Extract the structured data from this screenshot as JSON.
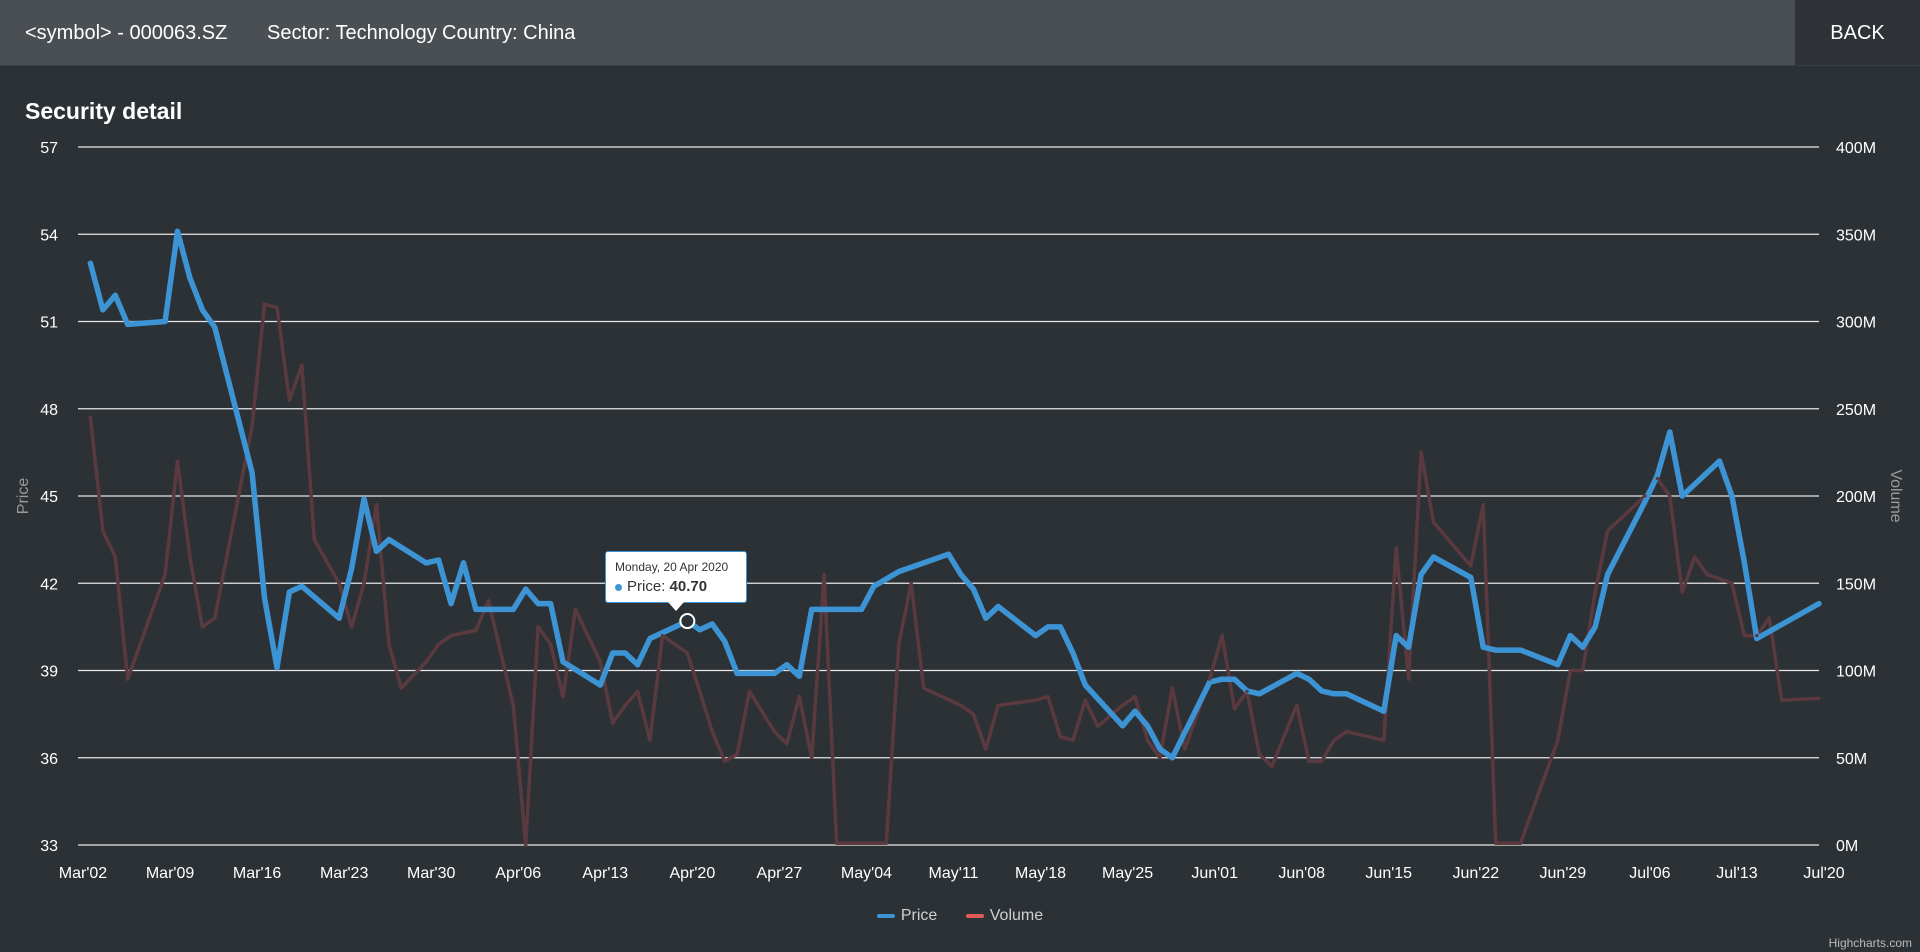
{
  "header": {
    "symbol_label": "<symbol> - 000063.SZ",
    "sector_label": "Sector: Technology",
    "country_label": "Country: China",
    "back_label": "BACK"
  },
  "tooltip": {
    "date": "Monday, 20 Apr 2020",
    "series": "Price",
    "value": "40.70"
  },
  "credits": "Highcharts.com",
  "colors": {
    "price": "#3d94d4",
    "volume": "#e05a5a",
    "volume_line": "#5a3a3f",
    "background": "#2c3136",
    "header": "#4a4f54"
  },
  "chart_data": {
    "type": "line",
    "title": "Security detail",
    "ylabel": "Price",
    "y2label": "Volume",
    "ylim": [
      33,
      57
    ],
    "yticks": [
      "33",
      "36",
      "39",
      "42",
      "45",
      "48",
      "51",
      "54",
      "57"
    ],
    "y2lim": [
      0,
      400
    ],
    "y2ticks": [
      "0M",
      "50M",
      "100M",
      "150M",
      "200M",
      "250M",
      "300M",
      "350M",
      "400M"
    ],
    "xlim": [
      0,
      140
    ],
    "xticks": [
      {
        "label": "Mar'02",
        "x": 0
      },
      {
        "label": "Mar'09",
        "x": 7
      },
      {
        "label": "Mar'16",
        "x": 14
      },
      {
        "label": "Mar'23",
        "x": 21
      },
      {
        "label": "Mar'30",
        "x": 28
      },
      {
        "label": "Apr'06",
        "x": 35
      },
      {
        "label": "Apr'13",
        "x": 42
      },
      {
        "label": "Apr'20",
        "x": 49
      },
      {
        "label": "Apr'27",
        "x": 56
      },
      {
        "label": "May'04",
        "x": 63
      },
      {
        "label": "May'11",
        "x": 70
      },
      {
        "label": "May'18",
        "x": 77
      },
      {
        "label": "May'25",
        "x": 84
      },
      {
        "label": "Jun'01",
        "x": 91
      },
      {
        "label": "Jun'08",
        "x": 98
      },
      {
        "label": "Jun'15",
        "x": 105
      },
      {
        "label": "Jun'22",
        "x": 112
      },
      {
        "label": "Jun'29",
        "x": 119
      },
      {
        "label": "Jul'06",
        "x": 126
      },
      {
        "label": "Jul'13",
        "x": 133
      },
      {
        "label": "Jul'20",
        "x": 140
      }
    ],
    "grid": true,
    "legend": "bottom-center",
    "series": [
      {
        "name": "Price",
        "color": "#3d94d4",
        "points": [
          [
            1,
            53.0
          ],
          [
            2,
            51.4
          ],
          [
            3,
            51.9
          ],
          [
            4,
            50.9
          ],
          [
            7,
            51.0
          ],
          [
            8,
            54.1
          ],
          [
            9,
            52.5
          ],
          [
            10,
            51.4
          ],
          [
            11,
            50.8
          ],
          [
            14,
            45.8
          ],
          [
            15,
            41.5
          ],
          [
            16,
            39.1
          ],
          [
            17,
            41.7
          ],
          [
            18,
            41.9
          ],
          [
            21,
            40.8
          ],
          [
            22,
            42.5
          ],
          [
            23,
            44.9
          ],
          [
            24,
            43.1
          ],
          [
            25,
            43.5
          ],
          [
            28,
            42.7
          ],
          [
            29,
            42.8
          ],
          [
            30,
            41.3
          ],
          [
            31,
            42.7
          ],
          [
            32,
            41.1
          ],
          [
            35,
            41.1
          ],
          [
            36,
            41.8
          ],
          [
            37,
            41.3
          ],
          [
            38,
            41.3
          ],
          [
            39,
            39.3
          ],
          [
            42,
            38.5
          ],
          [
            43,
            39.6
          ],
          [
            44,
            39.6
          ],
          [
            45,
            39.2
          ],
          [
            46,
            40.1
          ],
          [
            49,
            40.7
          ],
          [
            50,
            40.4
          ],
          [
            51,
            40.6
          ],
          [
            52,
            40.0
          ],
          [
            53,
            38.9
          ],
          [
            56,
            38.9
          ],
          [
            57,
            39.2
          ],
          [
            58,
            38.8
          ],
          [
            59,
            41.1
          ],
          [
            63,
            41.1
          ],
          [
            64,
            41.9
          ],
          [
            66,
            42.4
          ],
          [
            70,
            43.0
          ],
          [
            71,
            42.3
          ],
          [
            72,
            41.8
          ],
          [
            73,
            40.8
          ],
          [
            74,
            41.2
          ],
          [
            77,
            40.2
          ],
          [
            78,
            40.5
          ],
          [
            79,
            40.5
          ],
          [
            80,
            39.6
          ],
          [
            81,
            38.5
          ],
          [
            84,
            37.1
          ],
          [
            85,
            37.6
          ],
          [
            86,
            37.1
          ],
          [
            87,
            36.3
          ],
          [
            88,
            36.0
          ],
          [
            91,
            38.6
          ],
          [
            92,
            38.7
          ],
          [
            93,
            38.7
          ],
          [
            94,
            38.3
          ],
          [
            95,
            38.2
          ],
          [
            98,
            38.9
          ],
          [
            99,
            38.7
          ],
          [
            100,
            38.3
          ],
          [
            101,
            38.2
          ],
          [
            102,
            38.2
          ],
          [
            105,
            37.6
          ],
          [
            106,
            40.2
          ],
          [
            107,
            39.8
          ],
          [
            108,
            42.3
          ],
          [
            109,
            42.9
          ],
          [
            112,
            42.2
          ],
          [
            113,
            39.8
          ],
          [
            114,
            39.7
          ],
          [
            116,
            39.7
          ],
          [
            119,
            39.2
          ],
          [
            120,
            40.2
          ],
          [
            121,
            39.8
          ],
          [
            122,
            40.5
          ],
          [
            123,
            42.3
          ],
          [
            126,
            44.8
          ],
          [
            127,
            45.7
          ],
          [
            128,
            47.2
          ],
          [
            129,
            45.0
          ],
          [
            132,
            46.2
          ],
          [
            133,
            45.0
          ],
          [
            134,
            42.7
          ],
          [
            135,
            40.1
          ],
          [
            140,
            41.3
          ]
        ]
      },
      {
        "name": "Volume",
        "color": "#e05a5a",
        "points": [
          [
            1,
            245
          ],
          [
            2,
            180
          ],
          [
            3,
            165
          ],
          [
            4,
            95
          ],
          [
            7,
            155
          ],
          [
            8,
            220
          ],
          [
            9,
            165
          ],
          [
            10,
            125
          ],
          [
            11,
            130
          ],
          [
            14,
            240
          ],
          [
            15,
            310
          ],
          [
            16,
            308
          ],
          [
            17,
            255
          ],
          [
            18,
            275
          ],
          [
            19,
            175
          ],
          [
            21,
            150
          ],
          [
            22,
            125
          ],
          [
            23,
            150
          ],
          [
            24,
            195
          ],
          [
            25,
            115
          ],
          [
            26,
            90
          ],
          [
            28,
            105
          ],
          [
            29,
            115
          ],
          [
            30,
            120
          ],
          [
            32,
            123
          ],
          [
            33,
            140
          ],
          [
            35,
            80
          ],
          [
            36,
            0
          ],
          [
            37,
            125
          ],
          [
            38,
            115
          ],
          [
            39,
            85
          ],
          [
            40,
            135
          ],
          [
            42,
            105
          ],
          [
            43,
            70
          ],
          [
            44,
            80
          ],
          [
            45,
            88
          ],
          [
            46,
            60
          ],
          [
            47,
            120
          ],
          [
            49,
            110
          ],
          [
            50,
            88
          ],
          [
            51,
            65
          ],
          [
            52,
            48
          ],
          [
            53,
            52
          ],
          [
            54,
            88
          ],
          [
            56,
            65
          ],
          [
            57,
            58
          ],
          [
            58,
            85
          ],
          [
            59,
            50
          ],
          [
            60,
            155
          ],
          [
            61,
            1
          ],
          [
            64,
            1
          ],
          [
            65,
            1
          ],
          [
            66,
            115
          ],
          [
            67,
            150
          ],
          [
            68,
            90
          ],
          [
            71,
            80
          ],
          [
            72,
            75
          ],
          [
            73,
            55
          ],
          [
            74,
            80
          ],
          [
            77,
            83
          ],
          [
            78,
            85
          ],
          [
            79,
            62
          ],
          [
            80,
            60
          ],
          [
            81,
            83
          ],
          [
            82,
            68
          ],
          [
            84,
            80
          ],
          [
            85,
            85
          ],
          [
            86,
            60
          ],
          [
            87,
            50
          ],
          [
            88,
            90
          ],
          [
            89,
            55
          ],
          [
            91,
            95
          ],
          [
            92,
            120
          ],
          [
            93,
            78
          ],
          [
            94,
            88
          ],
          [
            95,
            52
          ],
          [
            96,
            45
          ],
          [
            98,
            80
          ],
          [
            99,
            48
          ],
          [
            100,
            48
          ],
          [
            101,
            60
          ],
          [
            102,
            65
          ],
          [
            105,
            60
          ],
          [
            106,
            170
          ],
          [
            107,
            95
          ],
          [
            108,
            225
          ],
          [
            109,
            185
          ],
          [
            112,
            160
          ],
          [
            113,
            195
          ],
          [
            114,
            1
          ],
          [
            115,
            1
          ],
          [
            116,
            1
          ],
          [
            119,
            60
          ],
          [
            120,
            100
          ],
          [
            121,
            100
          ],
          [
            122,
            145
          ],
          [
            123,
            180
          ],
          [
            126,
            200
          ],
          [
            127,
            210
          ],
          [
            128,
            200
          ],
          [
            129,
            145
          ],
          [
            130,
            165
          ],
          [
            131,
            155
          ],
          [
            133,
            150
          ],
          [
            134,
            120
          ],
          [
            135,
            120
          ],
          [
            136,
            130
          ],
          [
            137,
            83
          ],
          [
            140,
            84
          ]
        ]
      }
    ]
  }
}
